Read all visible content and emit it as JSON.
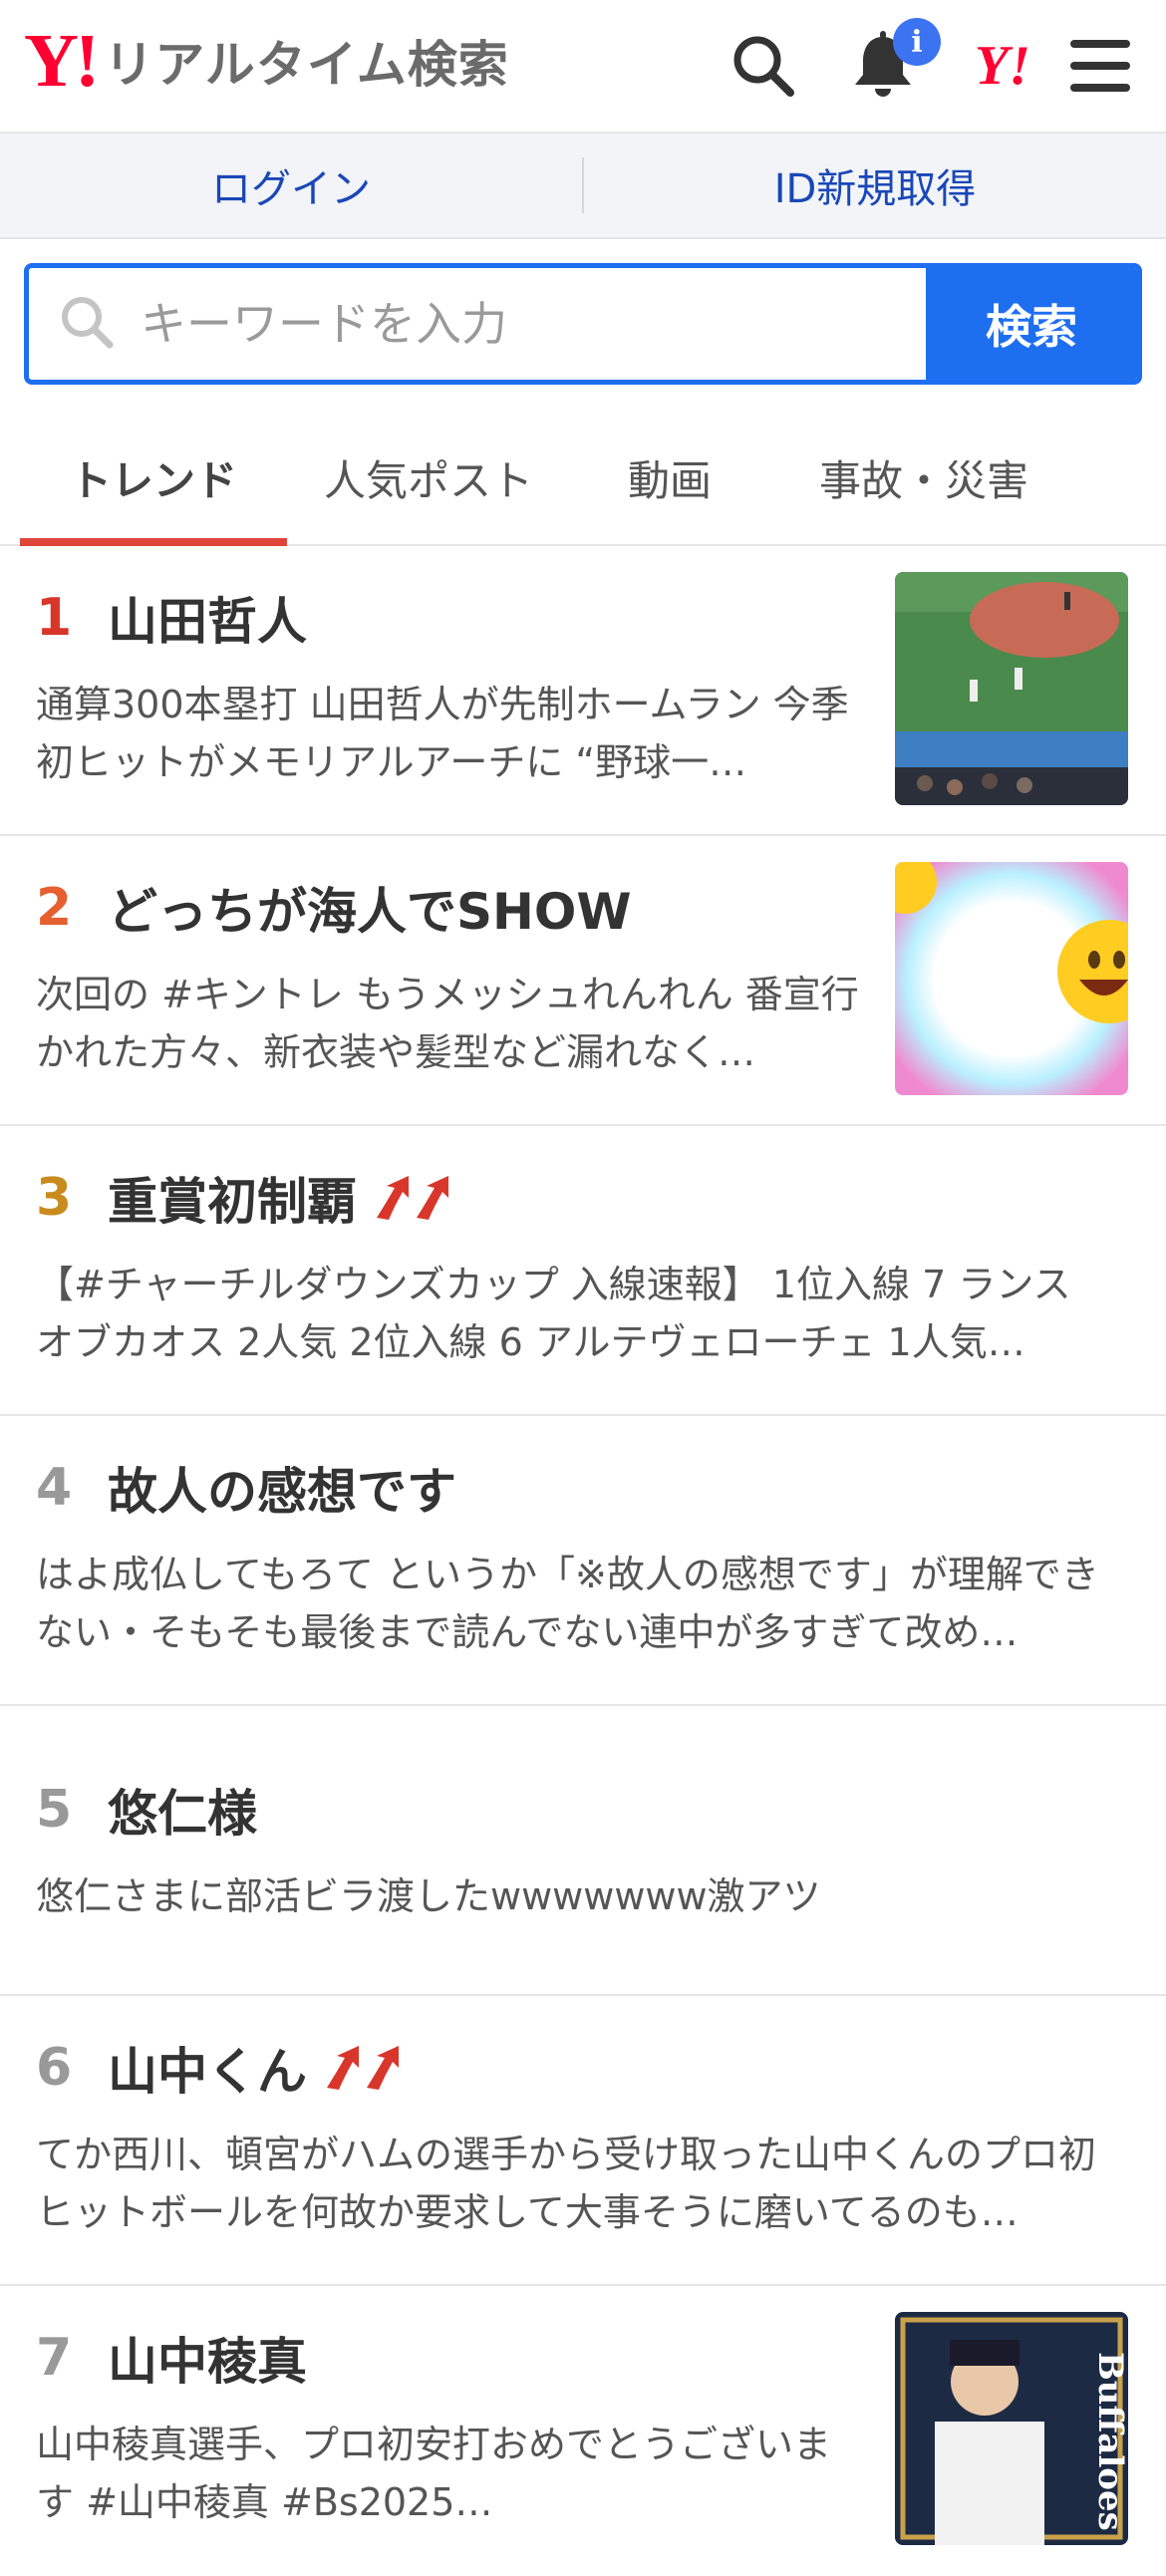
{
  "header": {
    "logo_mark": "Y!",
    "logo_text": "リアルタイム検索",
    "notification_badge": "i",
    "yahoo_mark": "Y!"
  },
  "login_bar": {
    "login": "ログイン",
    "register": "ID新規取得"
  },
  "search": {
    "placeholder": "キーワードを入力",
    "button": "検索"
  },
  "tabs": [
    {
      "label": "トレンド",
      "active": true
    },
    {
      "label": "人気ポスト",
      "active": false
    },
    {
      "label": "動画",
      "active": false
    },
    {
      "label": "事故・災害",
      "active": false
    }
  ],
  "trends": [
    {
      "rank": "1",
      "title": "山田哲人",
      "desc": "通算300本塁打 山田哲人が先制ホームラン 今季初ヒットがメモリアルアーチに “野球一…",
      "thumbnail": "baseball-field"
    },
    {
      "rank": "2",
      "title": "どっちが海人でSHOW",
      "desc": "次回の #キントレ もうメッシュれんれん 番宣行かれた方々、新衣装や髪型など漏れなく…",
      "thumbnail": "emoji-burst"
    },
    {
      "rank": "3",
      "title": "重賞初制覇",
      "rising": true,
      "desc": "【#チャーチルダウンズカップ 入線速報】 1位入線 7 ランスオブカオス 2人気 2位入線 6 アルテヴェローチェ 1人気…"
    },
    {
      "rank": "4",
      "title": "故人の感想です",
      "desc": "はよ成仏してもろて というか「※故人の感想です」が理解できない・そもそも最後まで読んでない連中が多すぎて改め…"
    },
    {
      "rank": "5",
      "title": "悠仁様",
      "desc": "悠仁さまに部活ビラ渡したwwwwwww激アツ"
    },
    {
      "rank": "6",
      "title": "山中くん",
      "rising": true,
      "desc": "てか西川、頓宮がハムの選手から受け取った山中くんのプロ初ヒットボールを何故か要求して大事そうに磨いてるのも…"
    },
    {
      "rank": "7",
      "title": "山中稜真",
      "desc": "山中稜真選手、プロ初安打おめでとうございます #山中稜真 #Bs2025…",
      "thumbnail": "buffaloes-card",
      "thumb_text": "Buffaloes"
    }
  ],
  "colors": {
    "accent_blue": "#1e6ff0",
    "yahoo_red": "#ff0033",
    "tab_underline": "#e0453b",
    "rising_arrow": "#d8362b"
  }
}
